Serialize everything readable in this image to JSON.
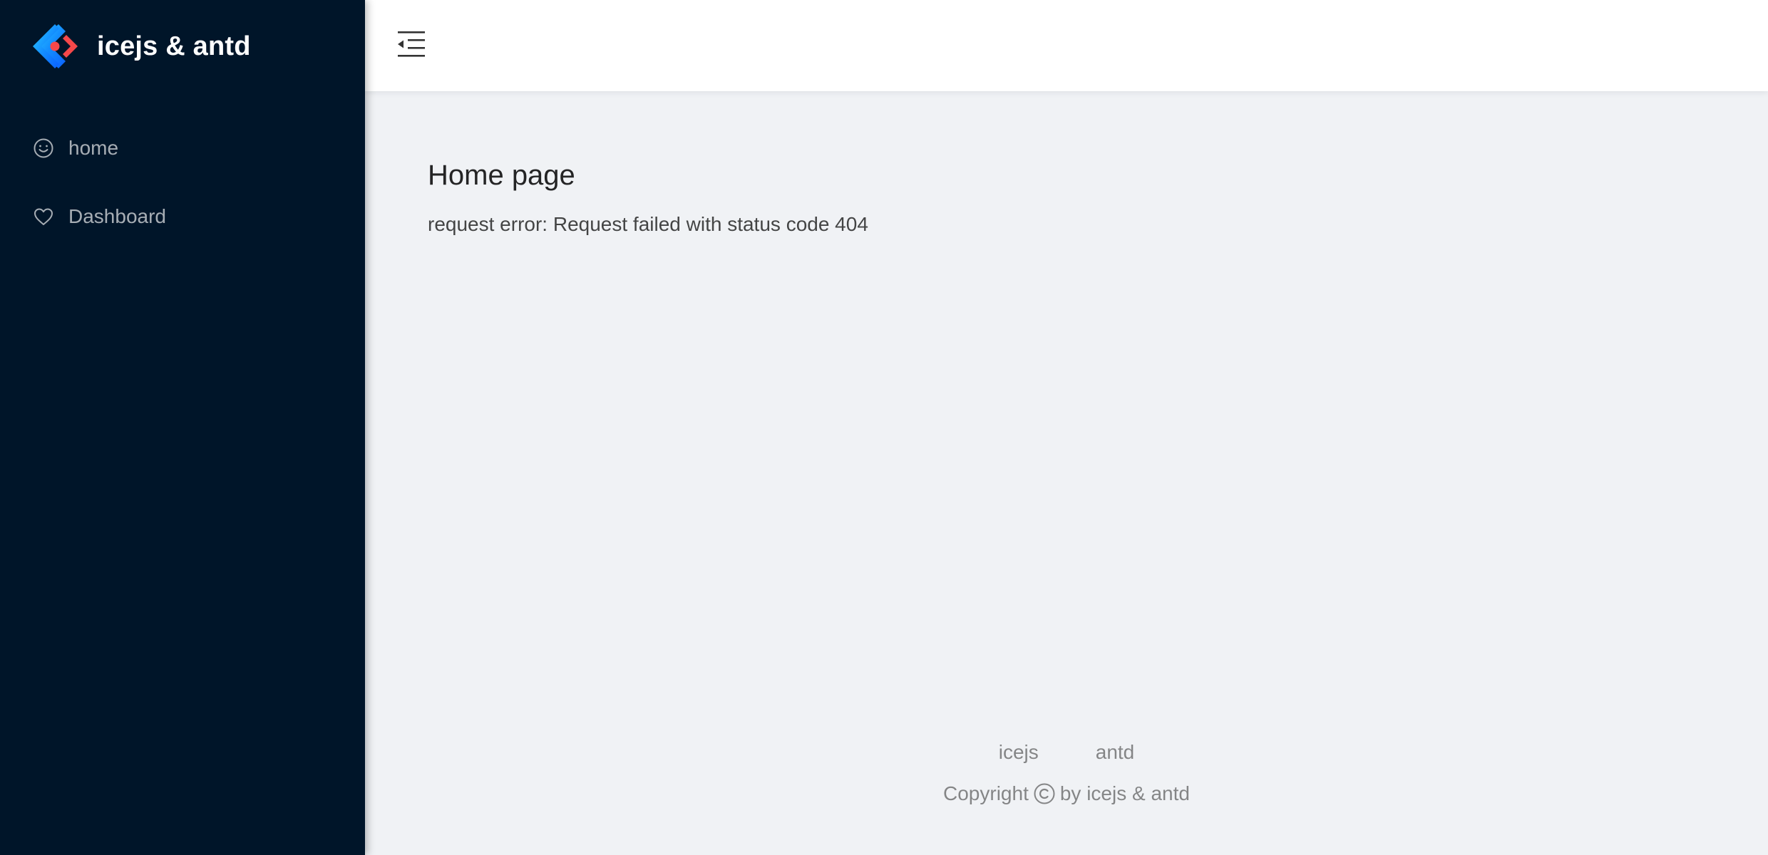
{
  "sidebar": {
    "title": "icejs & antd",
    "logo_icon": "ice-logo-icon",
    "items": [
      {
        "label": "home",
        "icon": "smile-icon"
      },
      {
        "label": "Dashboard",
        "icon": "heart-icon"
      }
    ]
  },
  "header": {
    "collapse_icon": "menu-fold-icon"
  },
  "main": {
    "title": "Home page",
    "error": "request error: Request failed with status code 404"
  },
  "footer": {
    "links": [
      "icejs",
      "antd"
    ],
    "copyright_prefix": "Copyright",
    "copyright_suffix": "by icejs & antd"
  },
  "colors": {
    "sidebar_bg": "#001529",
    "content_bg": "#f0f2f5",
    "logo_blue": "#1890ff",
    "logo_red": "#f5484a"
  }
}
